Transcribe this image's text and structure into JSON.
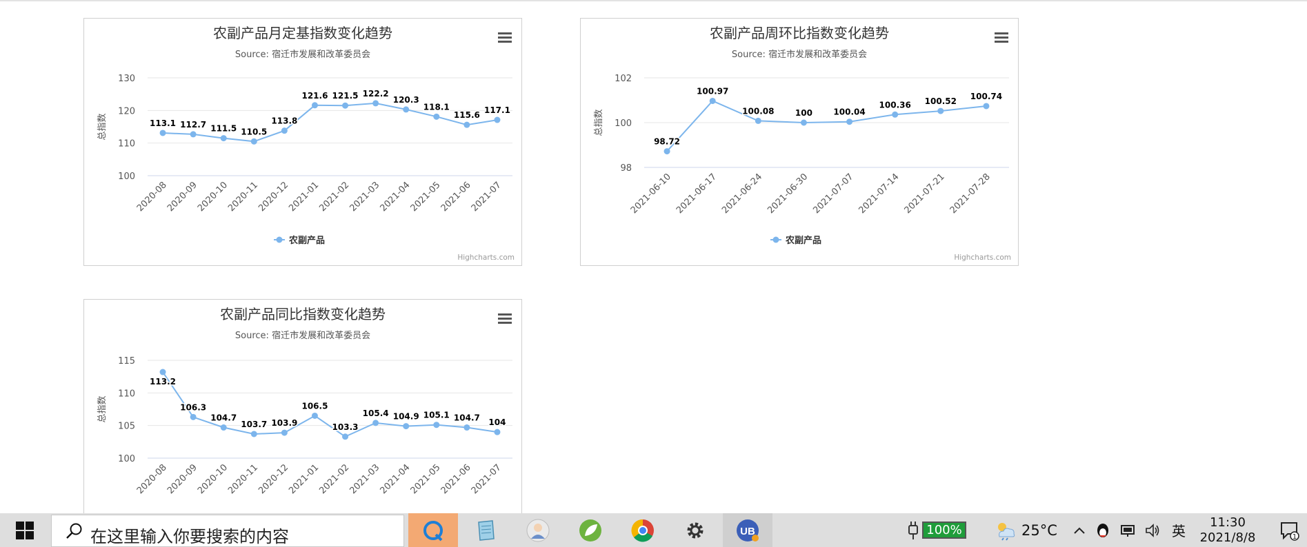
{
  "charts": [
    {
      "title": "农副产品月定基指数变化趋势",
      "subtitle": "Source: 宿迁市发展和改革委员会",
      "ylabel": "总指数",
      "credits": "Highcharts.com",
      "legend": "农副产品",
      "menu_icon": "hamburger-menu-icon"
    },
    {
      "title": "农副产品周环比指数变化趋势",
      "subtitle": "Source: 宿迁市发展和改革委员会",
      "ylabel": "总指数",
      "credits": "Highcharts.com",
      "legend": "农副产品",
      "menu_icon": "hamburger-menu-icon"
    },
    {
      "title": "农副产品同比指数变化趋势",
      "subtitle": "Source: 宿迁市发展和改革委员会",
      "ylabel": "总指数",
      "credits": "",
      "legend": "",
      "menu_icon": "hamburger-menu-icon"
    }
  ],
  "chart_data": [
    {
      "type": "line",
      "title": "农副产品月定基指数变化趋势",
      "subtitle": "Source: 宿迁市发展和改革委员会",
      "ylabel": "总指数",
      "categories": [
        "2020-08",
        "2020-09",
        "2020-10",
        "2020-11",
        "2020-12",
        "2021-01",
        "2021-02",
        "2021-03",
        "2021-04",
        "2021-05",
        "2021-06",
        "2021-07"
      ],
      "series": [
        {
          "name": "农副产品",
          "values": [
            113.1,
            112.7,
            111.5,
            110.5,
            113.8,
            121.6,
            121.5,
            122.2,
            120.3,
            118.1,
            115.6,
            117.1
          ]
        }
      ],
      "yticks": [
        100,
        110,
        120,
        130
      ],
      "ylim": [
        100,
        130
      ],
      "grid": true,
      "legend": "bottom-center",
      "color": "#7cb5ec"
    },
    {
      "type": "line",
      "title": "农副产品周环比指数变化趋势",
      "subtitle": "Source: 宿迁市发展和改革委员会",
      "ylabel": "总指数",
      "categories": [
        "2021-06-10",
        "2021-06-17",
        "2021-06-24",
        "2021-06-30",
        "2021-07-07",
        "2021-07-14",
        "2021-07-21",
        "2021-07-28"
      ],
      "series": [
        {
          "name": "农副产品",
          "values": [
            98.72,
            100.97,
            100.08,
            100,
            100.04,
            100.36,
            100.52,
            100.74
          ]
        }
      ],
      "yticks": [
        98,
        100,
        102
      ],
      "ylim": [
        98,
        102
      ],
      "grid": true,
      "legend": "bottom-center",
      "color": "#7cb5ec"
    },
    {
      "type": "line",
      "title": "农副产品同比指数变化趋势",
      "subtitle": "Source: 宿迁市发展和改革委员会",
      "ylabel": "总指数",
      "categories": [
        "2020-08",
        "2020-09",
        "2020-10",
        "2020-11",
        "2020-12",
        "2021-01",
        "2021-02",
        "2021-03",
        "2021-04",
        "2021-05",
        "2021-06",
        "2021-07"
      ],
      "series": [
        {
          "name": "农副产品",
          "values": [
            113.2,
            106.3,
            104.7,
            103.7,
            103.9,
            106.5,
            103.3,
            105.4,
            104.9,
            105.1,
            104.7,
            104
          ]
        }
      ],
      "yticks": [
        100,
        105,
        110,
        115
      ],
      "ylim": [
        100,
        115
      ],
      "grid": true,
      "legend": "",
      "color": "#7cb5ec"
    }
  ],
  "taskbar": {
    "search_placeholder": "在这里输入你要搜索的内容",
    "apps": [
      "quick-assist-icon",
      "notepad-icon",
      "avatar-app-icon",
      "spring-leaf-icon",
      "chrome-icon",
      "gear-icon",
      "ub-app-icon"
    ],
    "battery_text": "100%",
    "weather_text": "25°C",
    "ime_text": "英",
    "time": "11:30",
    "date": "2021/8/8",
    "notification_count": "1"
  }
}
